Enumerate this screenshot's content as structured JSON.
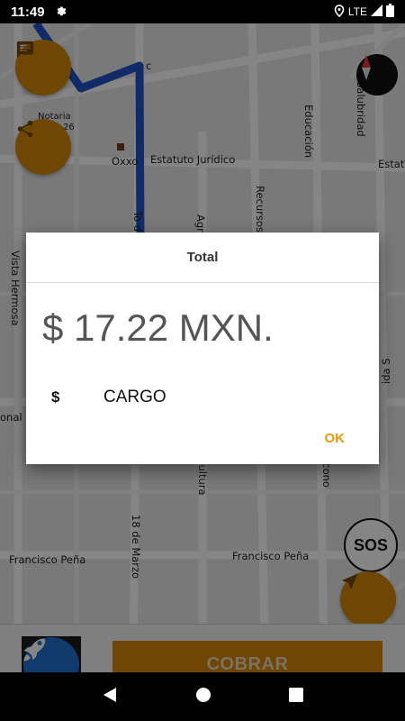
{
  "status_bar": {
    "time": "11:49",
    "network": "LTE"
  },
  "map": {
    "streets": {
      "notaria": "Notaria",
      "notaria_num": "26",
      "oxxo": "Oxxo",
      "estatuto": "Estatuto Jurídico",
      "estatuto_right": "Estatu",
      "salubridad": "Salubridad",
      "educacion": "Educación",
      "recursos": "Recursos",
      "agr": "Agr",
      "vista_hermosa": "Vista Hermosa",
      "onal": "onal",
      "cultura": "icultura",
      "econo": "Econo",
      "dieciocho_marzo": "18 de Marzo",
      "francisco_left": "Francisco Peña",
      "francisco_right": "Francisco Peña",
      "ida_s": "ida S",
      "to_d": "To d",
      "c_label": "c"
    }
  },
  "sos_label": "SOS",
  "cobrar_label": "COBRAR",
  "dialog": {
    "title": "Total",
    "amount": "$ 17.22 MXN.",
    "currency_symbol": "$",
    "charge_label": "CARGO",
    "ok_label": "OK"
  },
  "colors": {
    "accent": "#d4890a",
    "route": "#1f53c6",
    "ok": "#e69a10",
    "logo": "#1f6fd0"
  },
  "icons": [
    "settings-icon",
    "location-icon",
    "signal-icon",
    "battery-icon",
    "chat-icon",
    "share-icon",
    "compass-icon",
    "navigate-icon",
    "rocket-icon",
    "back-icon",
    "home-icon",
    "recents-icon",
    "dollar-icon"
  ]
}
